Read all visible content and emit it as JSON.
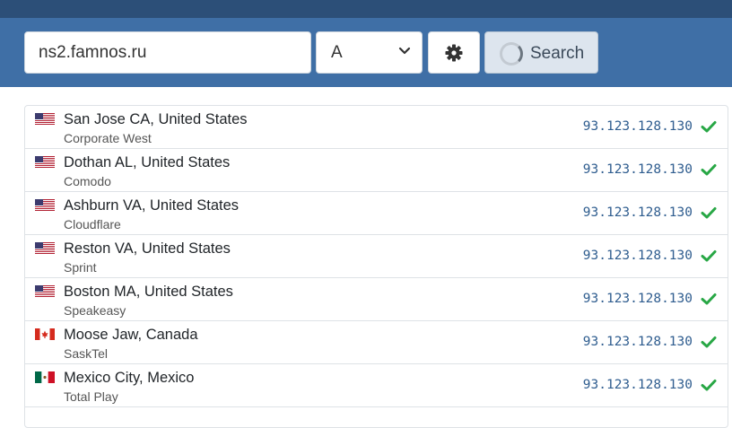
{
  "search": {
    "query": "ns2.famnos.ru",
    "record_type": "A",
    "button_label": "Search"
  },
  "colors": {
    "header_dark": "#2c4f78",
    "header": "#3f6fa6",
    "ip_text": "#2f5d8f",
    "success": "#28a745"
  },
  "results": [
    {
      "location": "San Jose CA, United States",
      "provider": "Corporate West",
      "ip": "93.123.128.130",
      "flag": "us-flag-icon",
      "status": "ok"
    },
    {
      "location": "Dothan AL, United States",
      "provider": "Comodo",
      "ip": "93.123.128.130",
      "flag": "us-flag-icon",
      "status": "ok"
    },
    {
      "location": "Ashburn VA, United States",
      "provider": "Cloudflare",
      "ip": "93.123.128.130",
      "flag": "us-flag-icon",
      "status": "ok"
    },
    {
      "location": "Reston VA, United States",
      "provider": "Sprint",
      "ip": "93.123.128.130",
      "flag": "us-flag-icon",
      "status": "ok"
    },
    {
      "location": "Boston MA, United States",
      "provider": "Speakeasy",
      "ip": "93.123.128.130",
      "flag": "us-flag-icon",
      "status": "ok"
    },
    {
      "location": "Moose Jaw, Canada",
      "provider": "SaskTel",
      "ip": "93.123.128.130",
      "flag": "ca-flag-icon",
      "status": "ok"
    },
    {
      "location": "Mexico City, Mexico",
      "provider": "Total Play",
      "ip": "93.123.128.130",
      "flag": "mx-flag-icon",
      "status": "ok"
    }
  ]
}
